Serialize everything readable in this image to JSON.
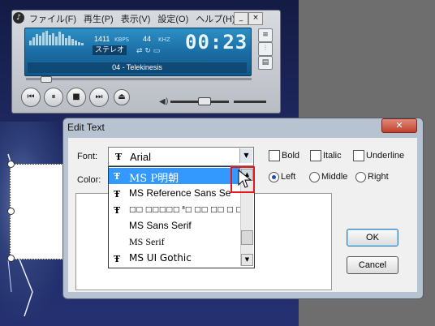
{
  "player": {
    "menu": [
      "ファイル(F)",
      "再生(P)",
      "表示(V)",
      "設定(O)",
      "ヘルプ(H)"
    ],
    "bitrate": "1411",
    "bitrate_unit": "KBPS",
    "khz": "44",
    "khz_unit": "KHZ",
    "channel": "ステレオ",
    "time": "00:23",
    "track": "04 - Telekinesis",
    "volume_level": 0.6,
    "seek_progress": 0.07
  },
  "dialog": {
    "title": "Edit Text",
    "close": "✕",
    "font_label": "Font:",
    "font_value": "Arial",
    "color_label": "Color:",
    "bold_label": "Bold",
    "italic_label": "Italic",
    "underline_label": "Underline",
    "align_left_label": "Left",
    "align_middle_label": "Middle",
    "align_right_label": "Right",
    "align_selected": "Left",
    "ok_label": "OK",
    "cancel_label": "Cancel"
  },
  "dropdown": {
    "items": [
      {
        "name": "MS P明朝",
        "truetype": true,
        "selected": true
      },
      {
        "name": "MS Reference Sans Se",
        "truetype": true
      },
      {
        "name": "□□ □□□□□ ⁸□ □□ □□ □ □⁴□",
        "truetype": true
      },
      {
        "name": "MS Sans Serif",
        "truetype": false
      },
      {
        "name": "MS Serif",
        "truetype": false
      },
      {
        "name": "MS UI Gothic",
        "truetype": true
      }
    ]
  },
  "icons": {
    "truetype": "Ŧ",
    "accent_highlight": "#3399ff",
    "annotation_color": "#e8141e"
  }
}
